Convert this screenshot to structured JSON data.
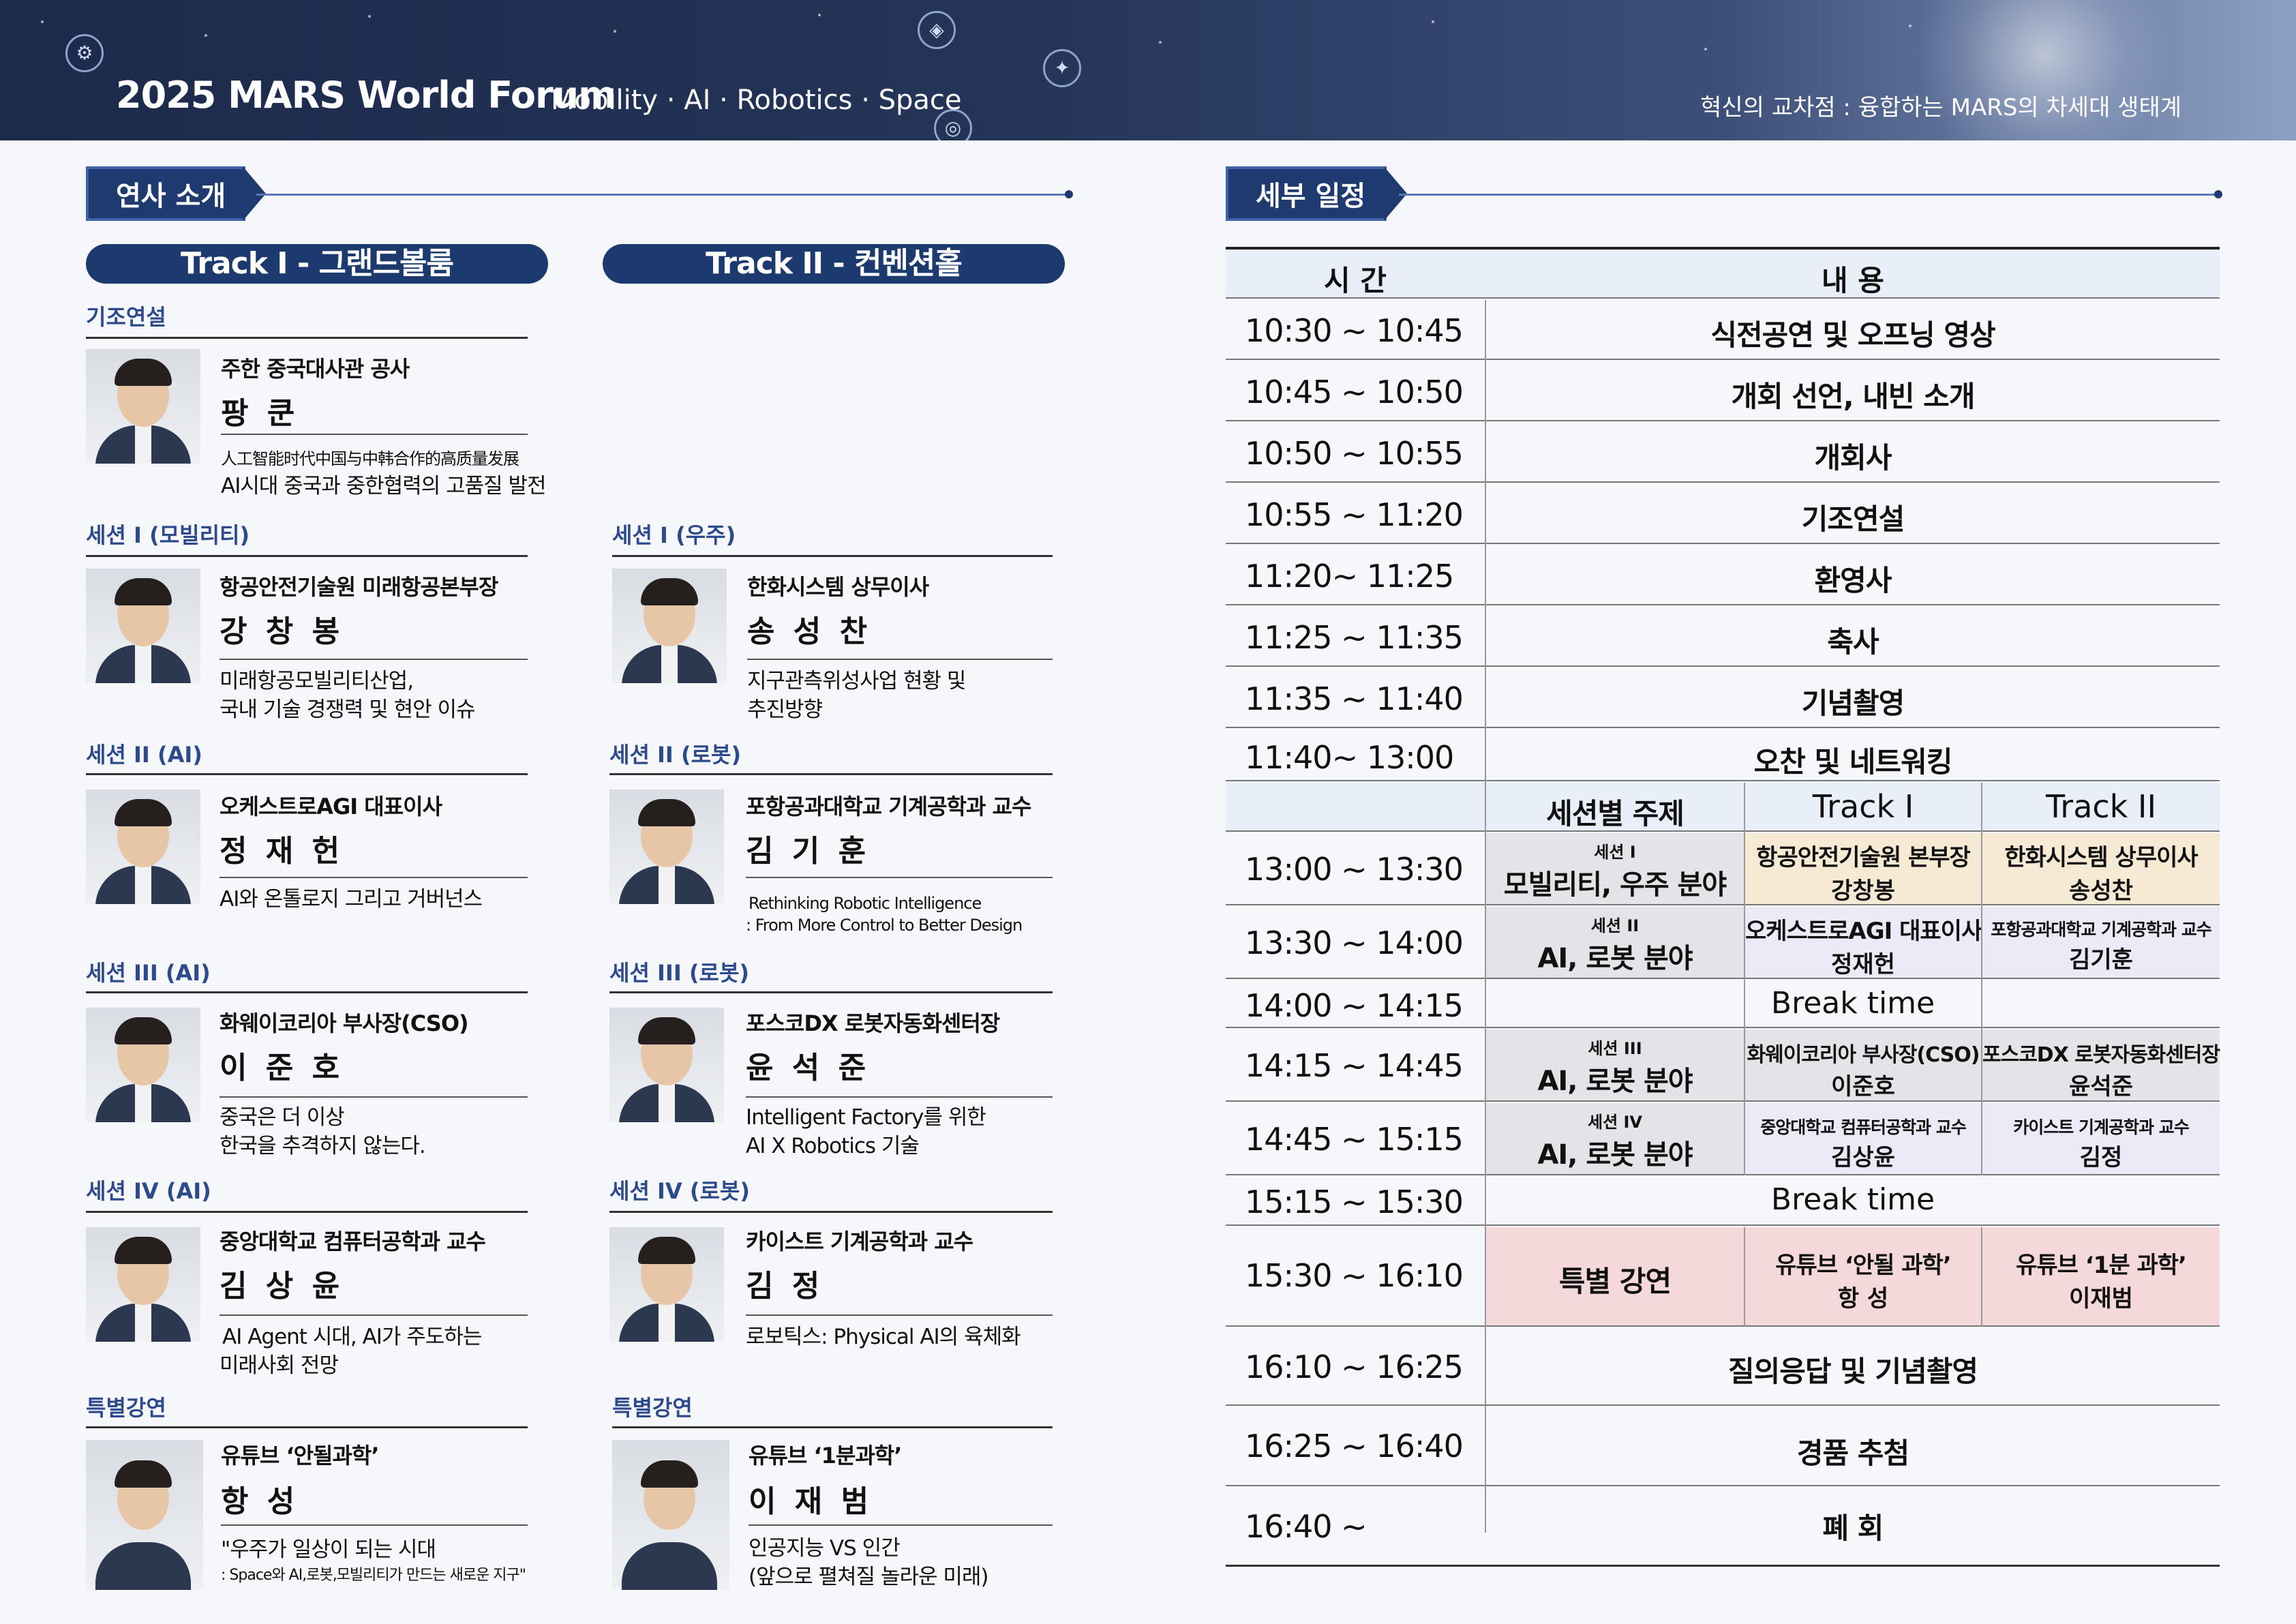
{
  "header": {
    "title": "2025 MARS World Forum",
    "subtitle": "Mobility · AI · Robotics · Space",
    "slogan": "혁신의 교차점 : 융합하는 MARS의 차세대 생태계"
  },
  "speakers_section": {
    "tab_label": "연사 소개",
    "track1_label": "Track I - 그랜드볼룸",
    "track2_label": "Track II - 컨벤션홀",
    "keynote_label": "기조연설",
    "keynote": {
      "org": "주한 중국대사관 공사",
      "name": "팡 쿤",
      "topic_line1": "人工智能时代中国与中韩合作的高质量发展",
      "topic_line2": "AI시대 중국과 중한협력의 고품질 발전"
    },
    "track1": [
      {
        "session": "세션 I (모빌리티)",
        "org": "항공안전기술원 미래항공본부장",
        "name": "강 창 봉",
        "topic_line1": "미래항공모빌리티산업,",
        "topic_line2": "국내 기술 경쟁력 및 현안 이슈"
      },
      {
        "session": "세션 II (AI)",
        "org": "오케스트로AGI 대표이사",
        "name": "정 재 헌",
        "topic_line1": "AI와 온톨로지 그리고 거버넌스",
        "topic_line2": ""
      },
      {
        "session": "세션 III (AI)",
        "org": "화웨이코리아 부사장(CSO)",
        "name": "이 준 호",
        "topic_line1": "중국은 더 이상",
        "topic_line2": "한국을 추격하지 않는다."
      },
      {
        "session": "세션 IV (AI)",
        "org": "중앙대학교 컴퓨터공학과 교수",
        "name": "김 상 윤",
        "topic_line1": "AI Agent 시대, AI가 주도하는",
        "topic_line2": "미래사회 전망"
      },
      {
        "session": "특별강연",
        "org": "유튜브 ‘안될과학’",
        "name": "항 성",
        "topic_line1": "\"우주가 일상이 되는 시대",
        "topic_line2": ": Space와 AI,로봇,모빌리티가 만드는 새로운 지구\""
      }
    ],
    "track2": [
      {
        "session": "세션 I (우주)",
        "org": "한화시스템 상무이사",
        "name": "송 성 찬",
        "topic_line1": "지구관측위성사업 현황 및",
        "topic_line2": "추진방향"
      },
      {
        "session": "세션 II (로봇)",
        "org": "포항공과대학교 기계공학과 교수",
        "name": "김 기 훈",
        "topic_line1": "Rethinking Robotic Intelligence",
        "topic_line2": ": From More Control to Better Design"
      },
      {
        "session": "세션 III (로봇)",
        "org": "포스코DX 로봇자동화센터장",
        "name": "윤 석 준",
        "topic_line1": "Intelligent Factory를 위한",
        "topic_line2": "AI X Robotics 기술"
      },
      {
        "session": "세션 IV (로봇)",
        "org": "카이스트 기계공학과 교수",
        "name": "김 정",
        "topic_line1": "로보틱스:  Physical AI의 육체화",
        "topic_line2": ""
      },
      {
        "session": "특별강연",
        "org": "유튜브 ‘1분과학’",
        "name": "이 재 범",
        "topic_line1": "인공지능 VS 인간",
        "topic_line2": "(앞으로 펼쳐질 놀라운 미래)"
      }
    ]
  },
  "schedule": {
    "tab_label": "세부 일정",
    "col_time": "시 간",
    "col_content": "내 용",
    "morning": [
      {
        "time": "10:30 ~ 10:45",
        "content": "식전공연 및 오프닝 영상"
      },
      {
        "time": "10:45 ~ 10:50",
        "content": "개회 선언, 내빈 소개"
      },
      {
        "time": "10:50 ~ 10:55",
        "content": "개회사"
      },
      {
        "time": "10:55 ~ 11:20",
        "content": "기조연설"
      },
      {
        "time": "11:20~ 11:25",
        "content": "환영사"
      },
      {
        "time": "11:25 ~ 11:35",
        "content": "축사"
      },
      {
        "time": "11:35 ~ 11:40",
        "content": "기념촬영"
      },
      {
        "time": "11:40~ 13:00",
        "content": "오찬 및 네트워킹"
      }
    ],
    "sub_header": {
      "topic": "세션별 주제",
      "track1": "Track I",
      "track2": "Track II"
    },
    "sessions": [
      {
        "time": "13:00 ~ 13:30",
        "session_no": "세션 I",
        "topic": "모빌리티, 우주 분야",
        "t1_org": "항공안전기술원 본부장",
        "t1_name": "강창봉",
        "t2_org": "한화시스템 상무이사",
        "t2_name": "송성찬"
      },
      {
        "time": "13:30 ~ 14:00",
        "session_no": "세션 II",
        "topic": "AI, 로봇 분야",
        "t1_org": "오케스트로AGI 대표이사",
        "t1_name": "정재헌",
        "t2_org": "포항공과대학교 기계공학과 교수",
        "t2_name": "김기훈"
      },
      {
        "time": "14:15 ~ 14:45",
        "session_no": "세션 III",
        "topic": "AI, 로봇 분야",
        "t1_org": "화웨이코리아 부사장(CSO)",
        "t1_name": "이준호",
        "t2_org": "포스코DX 로봇자동화센터장",
        "t2_name": "윤석준"
      },
      {
        "time": "14:45 ~ 15:15",
        "session_no": "세션 IV",
        "topic": "AI, 로봇 분야",
        "t1_org": "중앙대학교 컴퓨터공학과 교수",
        "t1_name": "김상윤",
        "t2_org": "카이스트 기계공학과 교수",
        "t2_name": "김정"
      }
    ],
    "break1": {
      "time": "14:00 ~ 14:15",
      "content": "Break time"
    },
    "break2": {
      "time": "15:15 ~ 15:30",
      "content": "Break time"
    },
    "special": {
      "time": "15:30 ~ 16:10",
      "label": "특별 강연",
      "t1_org": "유튜브 ‘안될 과학’",
      "t1_name": "항 성",
      "t2_org": "유튜브 ‘1분 과학’",
      "t2_name": "이재범"
    },
    "closing": [
      {
        "time": "16:10 ~ 16:25",
        "content": "질의응답 및 기념촬영"
      },
      {
        "time": "16:25 ~ 16:40",
        "content": "경품 추첨"
      },
      {
        "time": "16:40 ~",
        "content": "폐 회"
      }
    ]
  }
}
